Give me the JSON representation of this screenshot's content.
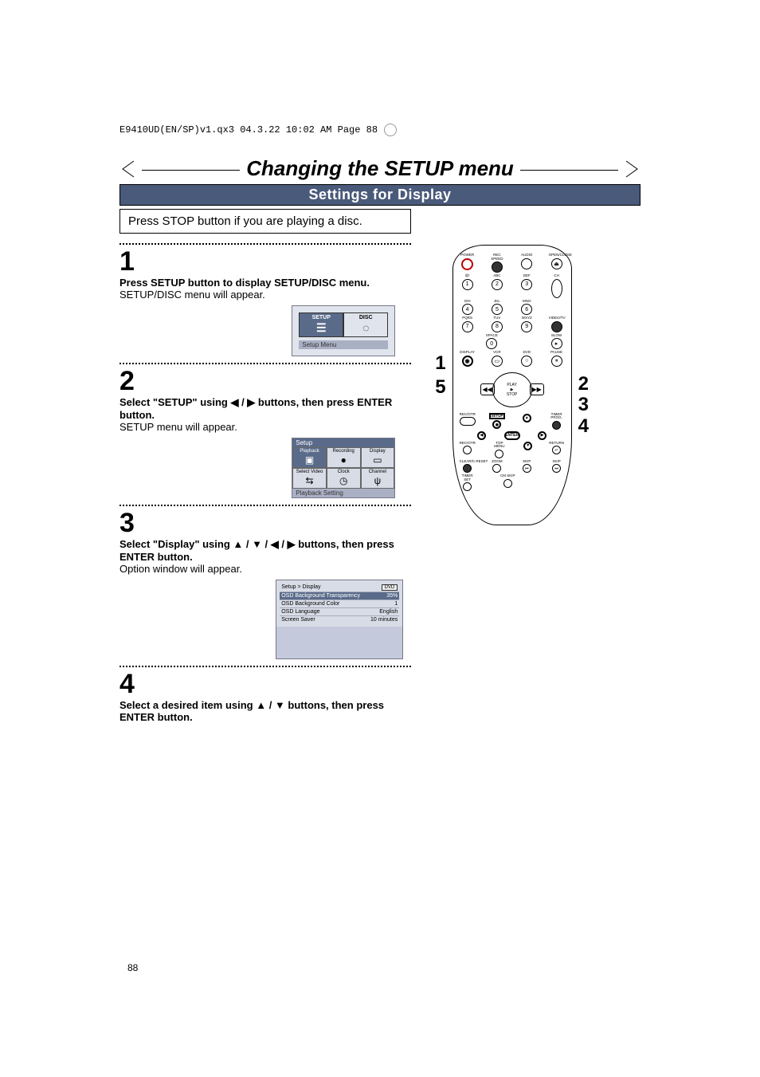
{
  "header_info": "E9410UD(EN/SP)v1.qx3  04.3.22  10:02 AM  Page 88",
  "main_title": "Changing the SETUP menu",
  "subtitle": "Settings for Display",
  "note_box": "Press STOP button if you are playing a disc.",
  "steps": [
    {
      "num": "1",
      "heading": "Press SETUP button to display SETUP/DISC menu.",
      "body": "SETUP/DISC menu will appear."
    },
    {
      "num": "2",
      "heading": "Select \"SETUP\" using ◀ / ▶ buttons, then press ENTER button.",
      "body": "SETUP menu will appear."
    },
    {
      "num": "3",
      "heading": "Select \"Display\" using ▲ / ▼ / ◀ / ▶ buttons, then press ENTER button.",
      "body": "Option window will appear."
    },
    {
      "num": "4",
      "heading": "Select a desired item using ▲ / ▼ buttons, then press ENTER button.",
      "body": ""
    }
  ],
  "setup_menu_screen": {
    "tabs": [
      "SETUP",
      "DISC"
    ],
    "caption": "Setup Menu"
  },
  "setup_screen": {
    "title": "Setup",
    "tiles": [
      "Playback",
      "Recording",
      "Display",
      "Select Video",
      "Clock",
      "Channel"
    ],
    "caption": "Playback Setting"
  },
  "display_screen": {
    "title": "Setup > Display",
    "badge": "DVD",
    "rows": [
      {
        "label": "OSD Background Transparency",
        "value": "35%"
      },
      {
        "label": "OSD Background Color",
        "value": "1"
      },
      {
        "label": "OSD Language",
        "value": "English"
      },
      {
        "label": "Screen Saver",
        "value": "10 minutes"
      }
    ]
  },
  "remote": {
    "left_callouts": [
      "1",
      "5"
    ],
    "right_callouts": [
      "2",
      "3",
      "4"
    ],
    "labels_row1": [
      "POWER",
      "REC SPEED",
      "AUDIO",
      "OPEN/CLOSE"
    ],
    "labels_row2": [
      "@!",
      "ABC",
      "DEF",
      ""
    ],
    "nums_row2": [
      "1",
      "2",
      "3",
      "CH"
    ],
    "labels_row3": [
      "GHI",
      "JKL",
      "MNO",
      ""
    ],
    "nums_row3": [
      "4",
      "5",
      "6",
      ""
    ],
    "labels_row4": [
      "PQRS",
      "TUV",
      "WXYZ",
      "VIDEO/TV"
    ],
    "nums_row4": [
      "7",
      "8",
      "9",
      ""
    ],
    "labels_row5": [
      "",
      "SPACE",
      "",
      "SLOW"
    ],
    "nums_row5": [
      "DISPLAY",
      "0",
      "DVD",
      "PAUSE"
    ],
    "labels_row5b": [
      "DISPLAY",
      "VCR",
      "DVD",
      "PAUSE"
    ],
    "play": "PLAY",
    "stop": "STOP",
    "labels_row6": [
      "REC/OTR",
      "SETUP",
      "",
      "TIMER PROG."
    ],
    "labels_row7": [
      "REC/OTR",
      "TOP MENU",
      "",
      "RETURN"
    ],
    "labels_row8": [
      "CLEAR/C.RESET",
      "ZOOM",
      "SKIP",
      "SKIP"
    ],
    "labels_row9": [
      "TIMER SET",
      "CM SKIP",
      "",
      ""
    ]
  },
  "page_number": "88"
}
